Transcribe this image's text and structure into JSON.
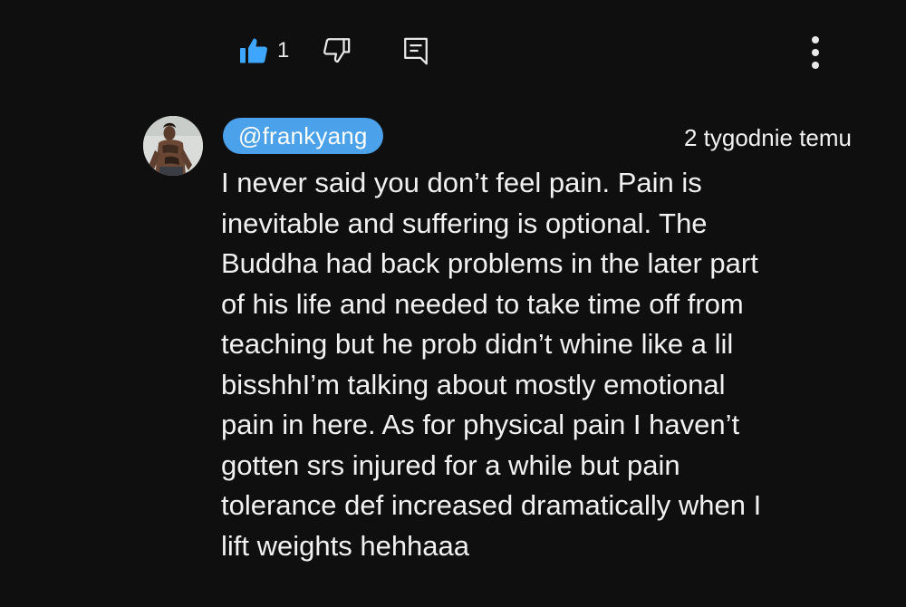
{
  "actions": {
    "like_icon": "thumbs-up-filled-icon",
    "like_count": "1",
    "dislike_icon": "thumbs-down-icon",
    "reply_icon": "reply-comment-icon",
    "more_icon": "more-vertical-icon"
  },
  "comment": {
    "author": "@frankyang",
    "timestamp": "2 tygodnie temu",
    "text_lines": [
      "I never said you don’t feel pain. Pain is",
      "inevitable and suffering is optional. The",
      "Buddha had back problems in the later part",
      "of his life and needed to take time off from",
      "teaching but he prob didn’t whine like a lil",
      "bisshhI’m talking about mostly emotional",
      "pain in here. As for physical pain I haven’t",
      "gotten srs injured for a while but pain",
      "tolerance def increased dramatically when I",
      "lift weights hehhaaa"
    ]
  },
  "colors": {
    "background": "#0f0f0f",
    "accent_blue": "#3ea6ff",
    "author_chip": "#4ba1ea",
    "text": "#f1f1f1"
  }
}
